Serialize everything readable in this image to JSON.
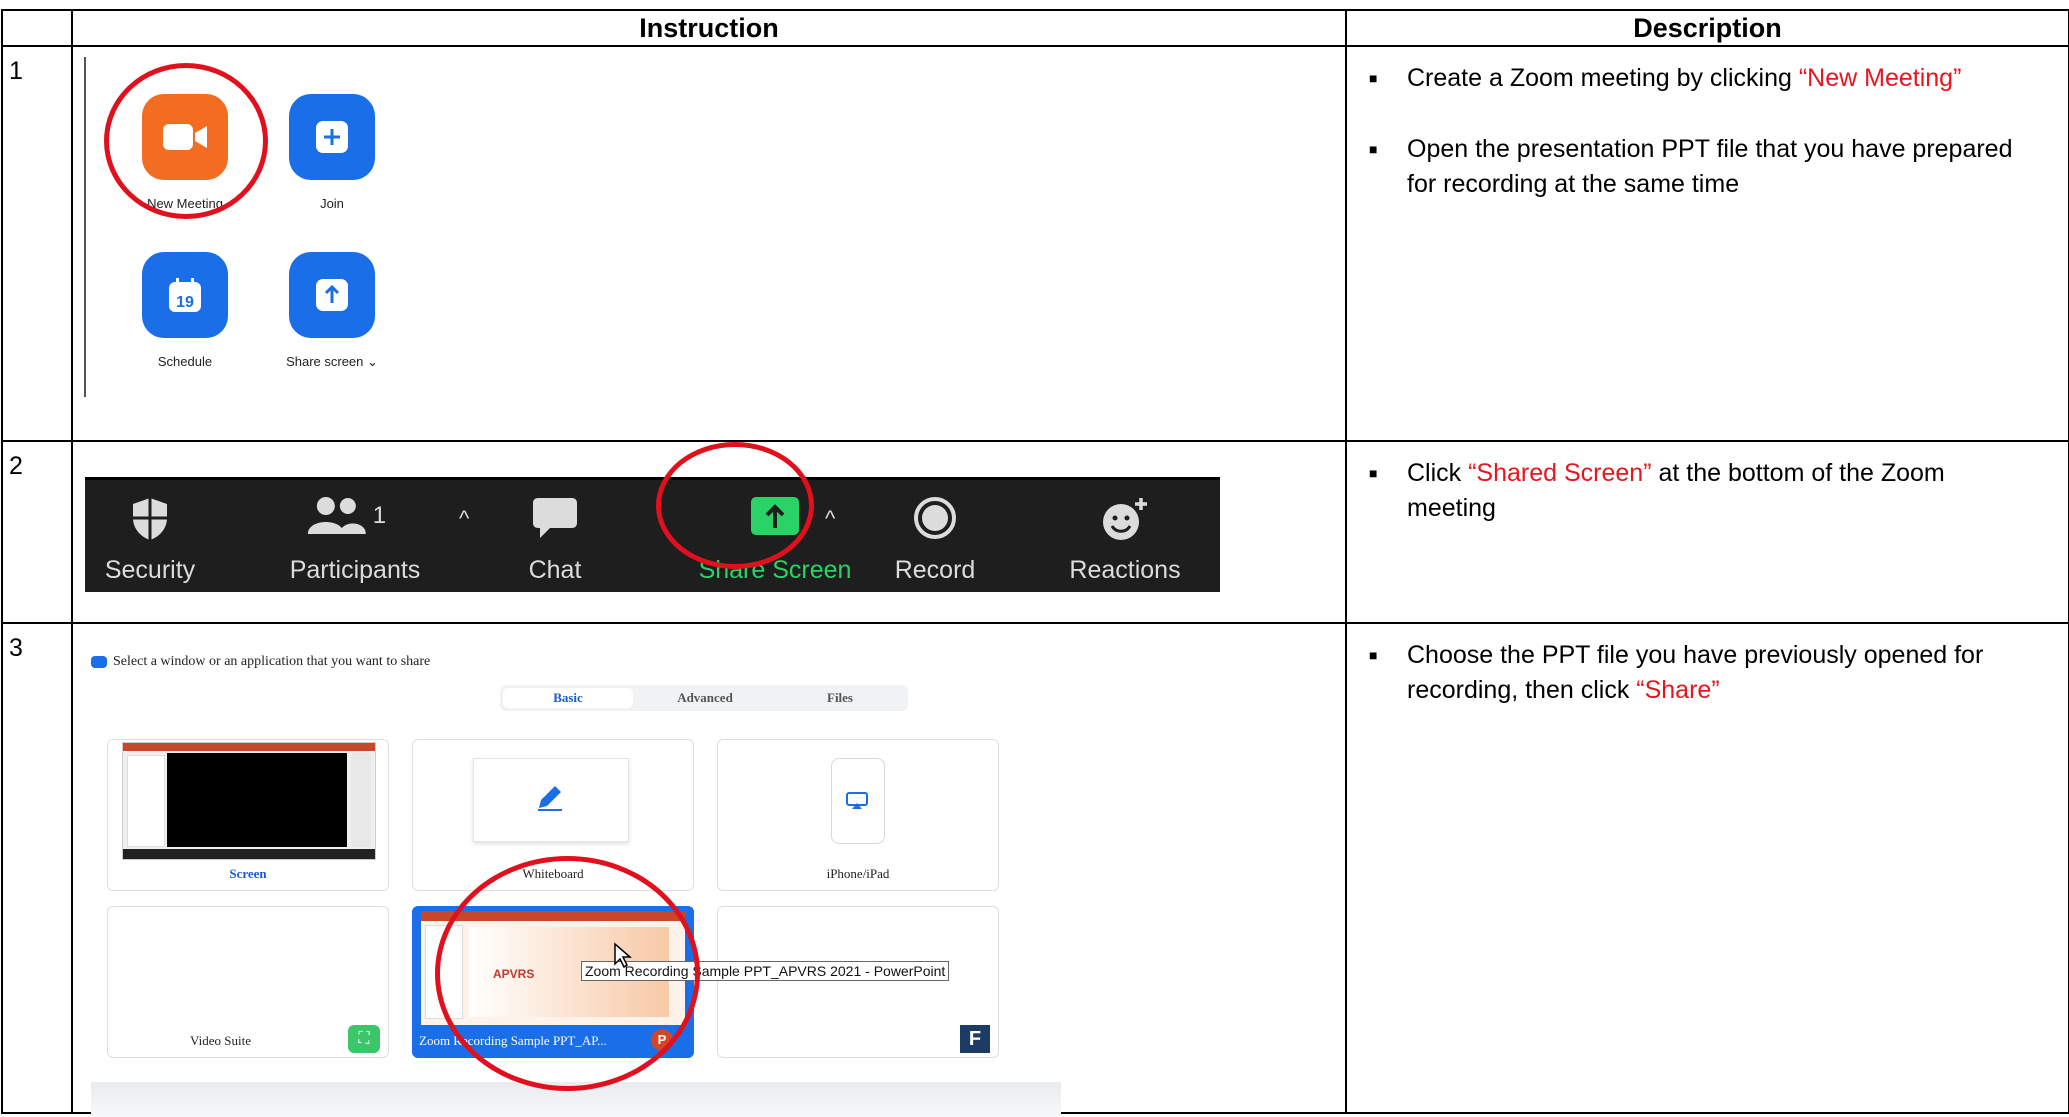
{
  "headers": {
    "col1": "",
    "col2": "Instruction",
    "col3": "Description"
  },
  "rows": [
    {
      "num": "1",
      "desc": [
        [
          {
            "t": "Create a Zoom meeting by clicking ",
            "red": false
          },
          {
            "t": "“New Meeting”",
            "red": true
          }
        ],
        [
          {
            "t": "Open the presentation PPT file that you have prepared for recording at the same time",
            "red": false
          }
        ]
      ]
    },
    {
      "num": "2",
      "desc": [
        [
          {
            "t": "Click ",
            "red": false
          },
          {
            "t": "“Shared Screen”",
            "red": true
          },
          {
            "t": " at the bottom of the Zoom meeting",
            "red": false
          }
        ]
      ]
    },
    {
      "num": "3",
      "desc": [
        [
          {
            "t": "Choose the PPT file you have previously opened for recording, then click ",
            "red": false
          },
          {
            "t": "“Share”",
            "red": true
          }
        ]
      ]
    }
  ],
  "zoom_home": {
    "new_meeting": "New Meeting",
    "join": "Join",
    "schedule": "Schedule",
    "schedule_day": "19",
    "share_screen": "Share screen",
    "icons": [
      "video-camera-icon",
      "plus-icon",
      "calendar-icon",
      "share-up-arrow-icon"
    ]
  },
  "toolbar": {
    "security": "Security",
    "participants": "Participants",
    "participants_count": "1",
    "chat": "Chat",
    "share_screen": "Share Screen",
    "record": "Record",
    "reactions": "Reactions",
    "share_color": "#2ad365"
  },
  "share_dialog": {
    "title": "Select a window or an application that you want to share",
    "tabs": [
      "Basic",
      "Advanced",
      "Files"
    ],
    "active_tab": "Basic",
    "cards": [
      "Screen",
      "Whiteboard",
      "iPhone/iPad",
      "Video Suite",
      "Zoom Recording Sample PPT_AP...",
      ""
    ],
    "tooltip": "Zoom Recording Sample PPT_APVRS 2021 - PowerPoint",
    "slide_logo": "APVRS",
    "file_badge": "F",
    "ppt_badge": "P"
  },
  "highlight_color": "#e0101c"
}
